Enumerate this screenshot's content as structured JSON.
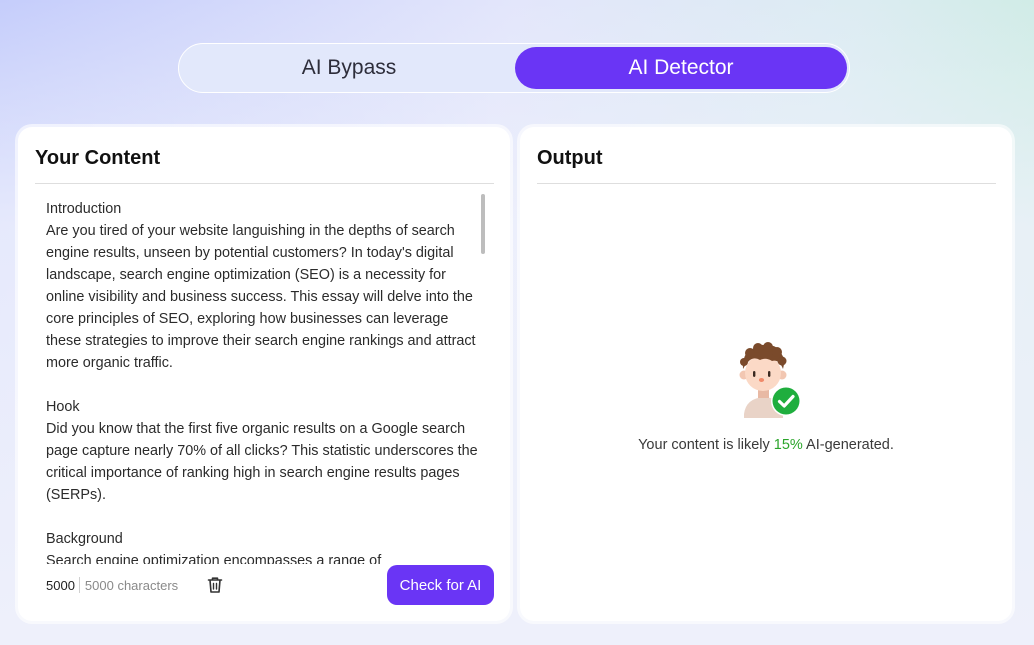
{
  "tabs": [
    {
      "label": "AI Bypass",
      "active": false
    },
    {
      "label": "AI Detector",
      "active": true
    }
  ],
  "input_panel": {
    "title": "Your Content",
    "text": "Introduction\nAre you tired of your website languishing in the depths of search engine results, unseen by potential customers? In today's digital landscape, search engine optimization (SEO) is a necessity for online visibility and business success. This essay will delve into the core principles of SEO, exploring how businesses can leverage these strategies to improve their search engine rankings and attract more organic traffic.\n\nHook\nDid you know that the first five organic results on a Google search page capture nearly 70% of all clicks? This statistic underscores the critical importance of ranking high in search engine results pages (SERPs).\n\nBackground\nSearch engine optimization encompasses a range of",
    "char_count": "5000",
    "char_limit": "5000 characters",
    "trash_icon": "trash-icon",
    "submit_label": "Check for AI"
  },
  "output_panel": {
    "title": "Output",
    "avatar_icon": "avatar-check-icon",
    "result_prefix": "Your content is likely ",
    "result_percent": "15%",
    "result_suffix": " AI-generated."
  },
  "colors": {
    "accent": "#6a35f5",
    "success": "#2aa52a"
  }
}
